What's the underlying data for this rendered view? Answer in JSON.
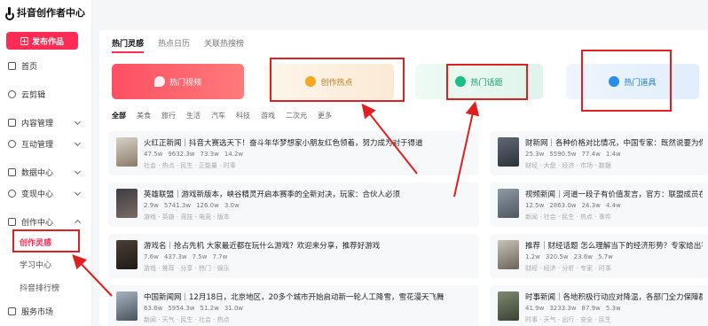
{
  "app": {
    "title": "抖音创作者中心"
  },
  "sidebar": {
    "publish_label": "发布作品",
    "items": [
      {
        "label": "首页"
      },
      {
        "label": "云剪辑"
      },
      {
        "label": "内容管理"
      },
      {
        "label": "互动管理"
      },
      {
        "label": "数据中心"
      },
      {
        "label": "变现中心"
      },
      {
        "label": "创作中心"
      }
    ],
    "subitems": [
      {
        "label": "创作灵感"
      },
      {
        "label": "学习中心"
      },
      {
        "label": "抖音排行榜"
      }
    ],
    "bottom_item": {
      "label": "服务市场"
    }
  },
  "main": {
    "tabs": [
      {
        "label": "热门灵感"
      },
      {
        "label": "热点日历"
      },
      {
        "label": "关联热搜榜"
      }
    ],
    "categories": [
      {
        "label": "热门视频"
      },
      {
        "label": "创作热点"
      },
      {
        "label": "热门话题"
      },
      {
        "label": "热门道具"
      }
    ],
    "filters": [
      "全部",
      "美食",
      "旅行",
      "生活",
      "汽车",
      "科技",
      "游戏",
      "二次元",
      "更多"
    ],
    "rows": [
      {
        "title": "火红正新闻｜抖音大赛选天下！奋斗年华梦想家小朋友红色领着，努力成为对于得道",
        "stats": [
          "47.5w",
          "9632.3w",
          "73.3w",
          "14.2w"
        ],
        "tags": "社会 · 热点 · 民生 · 正能量 · 时事"
      },
      {
        "title": "财新网｜各种价格对比情况，中国专家：既然说要为你带来更多数据",
        "stats": [
          "25.3w",
          "5590.5w",
          "77.4w",
          "1.4w"
        ],
        "tags": "财经 · 大盘 · 经济 · 市场 · 数据"
      },
      {
        "title": "英雄联盟｜游戏新版本，峡谷精灵开启本赛季的全新对决，玩家：合伙人必须",
        "stats": [
          "2.9w",
          "5741.3w",
          "126.0w",
          "3.0w"
        ],
        "tags": "游戏 · 英雄 · 竞技 · 电竞 · 版本"
      },
      {
        "title": "视频新闻｜河道一段子有价值发言，官方：联盟成员在各处交流",
        "stats": [
          "12.5w",
          "2863.0w",
          "24.3w",
          "4.4w"
        ],
        "tags": "新闻 · 社会 · 民生 · 热点 · 事件"
      },
      {
        "title": "游戏名｜抢占先机 大家最近都在玩什么游戏？欢迎来分享，推荐好游戏",
        "stats": [
          "7.6w",
          "437.3w",
          "7.5w",
          "7.7w"
        ],
        "tags": "游戏 · 推荐 · 分享 · 热门 · 娱乐"
      },
      {
        "title": "推荐｜财经话题 怎么理解当下的经济形势？专家给出答案",
        "stats": [
          "1.2w",
          "320.5w",
          "23.6w",
          "5.7w"
        ],
        "tags": "财经 · 经济 · 分析 · 专家 · 时事"
      },
      {
        "title": "中国新闻网｜12月18日，北京地区，20多个城市开始启动新一轮人工降雪，雪花漫天飞舞",
        "stats": [
          "63.6w",
          "5954.3w",
          "51.2w",
          "31.0w"
        ],
        "tags": "新闻 · 天气 · 民生 · 社会 · 热点"
      },
      {
        "title": "时事新闻｜各地积极行动应对降温，各部门全力保障群众出行安全，温馨提示注意保暖",
        "stats": [
          "41.9w",
          "3233.3w",
          "87.9w",
          "5.3w"
        ],
        "tags": "时事 · 天气 · 出行 · 安全 · 民生"
      }
    ]
  },
  "colors": {
    "brand": "#fe2c55",
    "annotation": "#e02020"
  }
}
